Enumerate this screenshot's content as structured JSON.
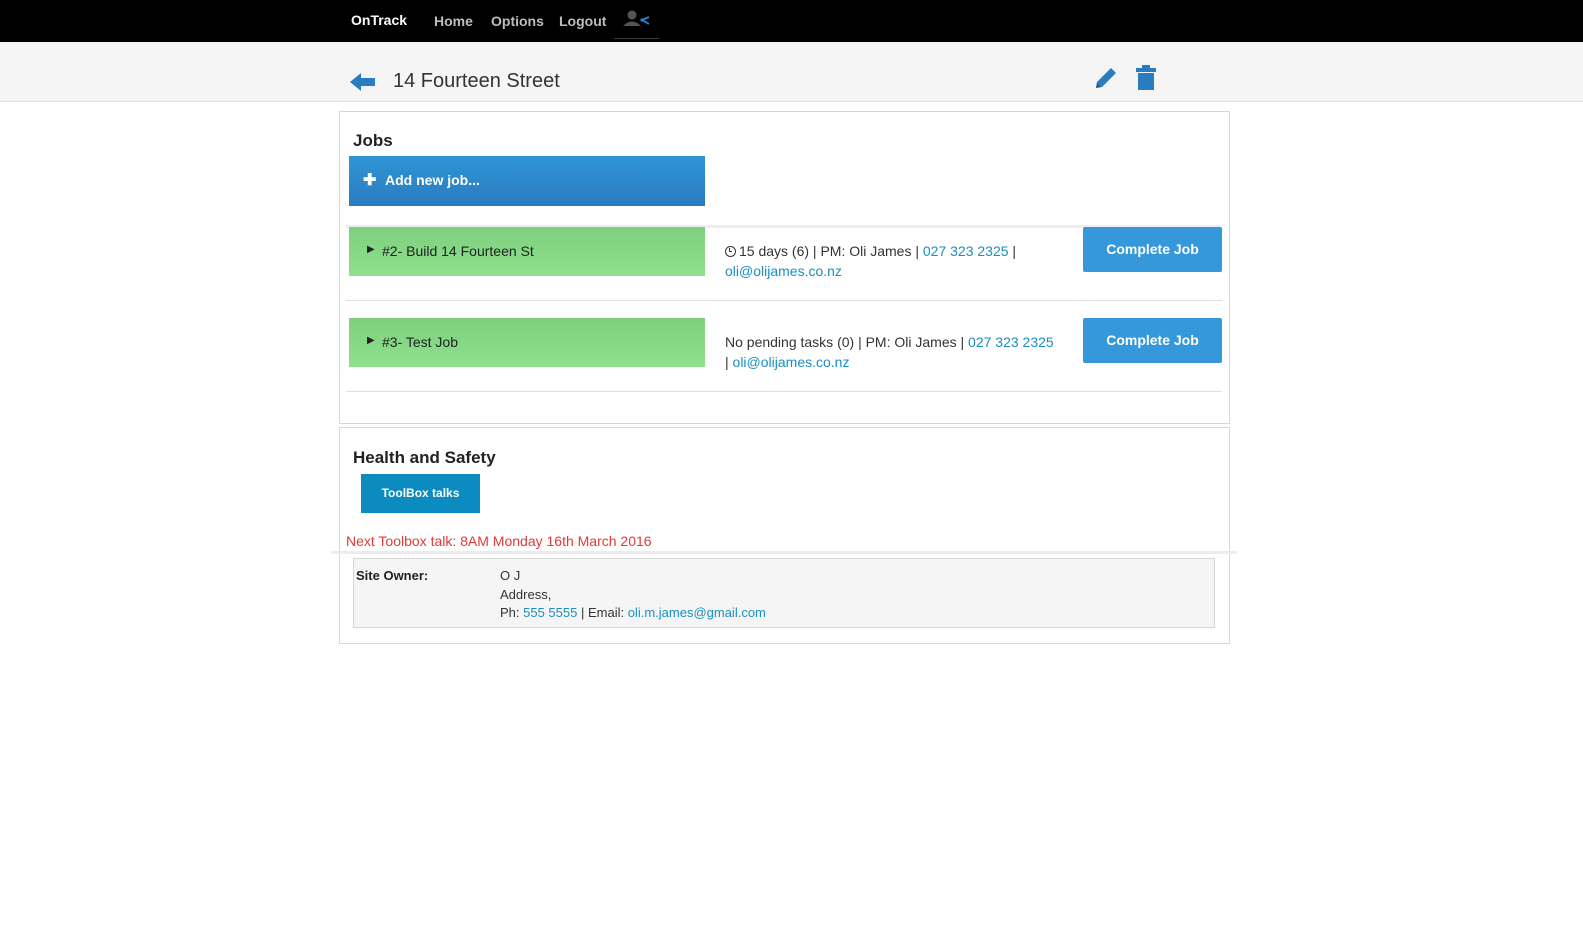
{
  "nav": {
    "brand": "OnTrack",
    "links": [
      "Home",
      "Options",
      "Logout"
    ]
  },
  "header": {
    "title": "14 Fourteen Street"
  },
  "jobs": {
    "heading": "Jobs",
    "add_label": "Add new job...",
    "items": [
      {
        "name": "#2- Build 14 Fourteen St",
        "status": "15 days (6) | PM: Oli James | ",
        "phone": "027 323 2325",
        "sep": " |",
        "email": "oli@olijames.co.nz",
        "complete_label": "Complete Job"
      },
      {
        "name": "#3- Test Job",
        "status": "No pending tasks (0) | PM: Oli James | ",
        "phone": "027 323 2325",
        "sep": "| ",
        "email": "oli@olijames.co.nz",
        "complete_label": "Complete Job"
      }
    ]
  },
  "health_safety": {
    "heading": "Health and Safety",
    "toolbox_label": "ToolBox talks",
    "next_talk": "Next Toolbox talk: 8AM Monday 16th March 2016"
  },
  "site_owner": {
    "label": "Site Owner:",
    "name": "O J",
    "address": "Address,",
    "phone_prefix": "Ph: ",
    "phone": "555 5555",
    "email_prefix": " | Email: ",
    "email": "oli.m.james@gmail.com"
  },
  "colors": {
    "accent": "#3498db",
    "job_green": "#8fe08f",
    "link": "#1a8fc1",
    "alert_red": "#e03a3a"
  }
}
